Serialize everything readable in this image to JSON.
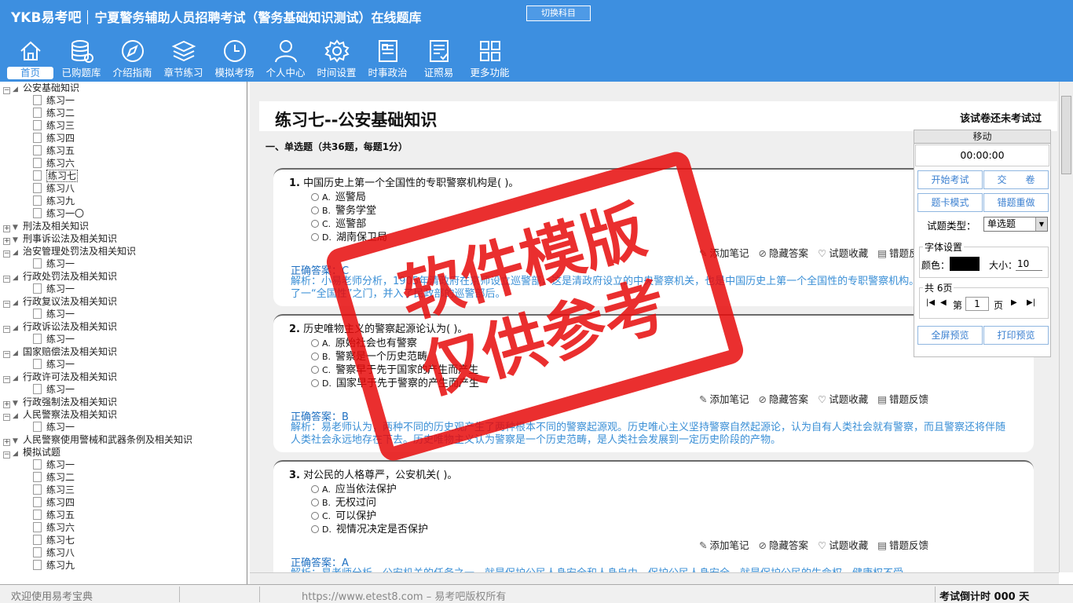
{
  "header": {
    "logo": "YKB易考吧",
    "title": "宁夏警务辅助人员招聘考试（警务基础知识测试）在线题库",
    "switch_label": "切换科目"
  },
  "nav": [
    {
      "label": "首页",
      "icon": "home-icon"
    },
    {
      "label": "已购题库",
      "icon": "database-icon"
    },
    {
      "label": "介绍指南",
      "icon": "compass-icon"
    },
    {
      "label": "章节练习",
      "icon": "layers-icon"
    },
    {
      "label": "模拟考场",
      "icon": "clock-icon"
    },
    {
      "label": "个人中心",
      "icon": "user-icon"
    },
    {
      "label": "时间设置",
      "icon": "gear-icon"
    },
    {
      "label": "时事政治",
      "icon": "news-icon"
    },
    {
      "label": "证照易",
      "icon": "certificate-icon"
    },
    {
      "label": "更多功能",
      "icon": "grid-icon"
    }
  ],
  "tree": [
    {
      "label": "公安基础知识",
      "expanded": true,
      "children": [
        "练习一",
        "练习二",
        "练习三",
        "练习四",
        "练习五",
        "练习六",
        "练习七",
        "练习八",
        "练习九",
        "练习一〇"
      ],
      "selected": "练习七"
    },
    {
      "label": "刑法及相关知识",
      "expanded": false,
      "children": []
    },
    {
      "label": "刑事诉讼法及相关知识",
      "expanded": false,
      "children": []
    },
    {
      "label": "治安管理处罚法及相关知识",
      "expanded": true,
      "children": [
        "练习一"
      ]
    },
    {
      "label": "行政处罚法及相关知识",
      "expanded": true,
      "children": [
        "练习一"
      ]
    },
    {
      "label": "行政复议法及相关知识",
      "expanded": true,
      "children": [
        "练习一"
      ]
    },
    {
      "label": "行政诉讼法及相关知识",
      "expanded": true,
      "children": [
        "练习一"
      ]
    },
    {
      "label": "国家赔偿法及相关知识",
      "expanded": true,
      "children": [
        "练习一"
      ]
    },
    {
      "label": "行政许可法及相关知识",
      "expanded": true,
      "children": [
        "练习一"
      ]
    },
    {
      "label": "行政强制法及相关知识",
      "expanded": false,
      "children": []
    },
    {
      "label": "人民警察法及相关知识",
      "expanded": true,
      "children": [
        "练习一"
      ]
    },
    {
      "label": "人民警察使用警械和武器条例及相关知识",
      "expanded": false,
      "children": []
    },
    {
      "label": "模拟试题",
      "expanded": true,
      "children": [
        "练习一",
        "练习二",
        "练习三",
        "练习四",
        "练习五",
        "练习六",
        "练习七",
        "练习八",
        "练习九"
      ]
    }
  ],
  "paper": {
    "title": "练习七--公安基础知识",
    "status": "该试卷还未考试过",
    "section": "一、单选题（共36题，每题1分）"
  },
  "questions": [
    {
      "number": "1.",
      "text": "中国历史上第一个全国性的专职警察机构是(    )。",
      "options": [
        [
          "A.",
          "巡警局"
        ],
        [
          "B.",
          "警务学堂"
        ],
        [
          "C.",
          "巡警部"
        ],
        [
          "D.",
          "湖南保卫局"
        ]
      ],
      "answer": "正确答案：C",
      "analysis": "解析：小易老师分析，1905年清政府在京师设立巡警部，这是清政府设立的中央警察机关，也是中国历史上第一个全国性的专职警察机构。巡警部同时要抓住了一“全国性”之门，并入了民政部的巡警部后。"
    },
    {
      "number": "2.",
      "text": "历史唯物主义的警察起源论认为(    )。",
      "options": [
        [
          "A.",
          "原始社会也有警察"
        ],
        [
          "B.",
          "警察是一个历史范畴"
        ],
        [
          "C.",
          "警察早于先于国家的产生而产生"
        ],
        [
          "D.",
          "国家早于先于警察的产生而产生"
        ]
      ],
      "answer": "正确答案：B",
      "analysis": "解析：易老师认为，两种不同的历史观产生了两种根本不同的警察起源观。历史唯心主义坚持警察自然起源论，认为自有人类社会就有警察，而且警察还将伴随人类社会永远地存在下去。历史唯物主义认为警察是一个历史范畴，是人类社会发展到一定历史阶段的产物。"
    },
    {
      "number": "3.",
      "text": "对公民的人格尊严，公安机关(    )。",
      "options": [
        [
          "A.",
          "应当依法保护"
        ],
        [
          "B.",
          "无权过问"
        ],
        [
          "C.",
          "可以保护"
        ],
        [
          "D.",
          "视情况决定是否保护"
        ]
      ],
      "answer": "正确答案：A",
      "analysis": "解析：易老师分析，公安机关的任务之一，就是保护公民人身安全和人身自由，保护公民人身安全，就是保护公民的生命权、健康权不受..."
    }
  ],
  "tools": {
    "note": "添加笔记",
    "hide": "隐藏答案",
    "fav": "试题收藏",
    "feedback": "错题反馈"
  },
  "panel": {
    "move": "移动",
    "timer": "00:00:00",
    "start": "开始考试",
    "submit": "交　　卷",
    "card_mode": "题卡模式",
    "redo_wrong": "错题重做",
    "qtype_label": "试题类型：",
    "qtype_value": "单选题",
    "font_legend": "字体设置",
    "color_label": "颜色：",
    "size_label": "大小：",
    "size_value": "10",
    "pages_legend": "共 6页",
    "page_prefix": "第",
    "page_value": "1",
    "page_suffix": "页",
    "fullscreen": "全屏预览",
    "print": "打印预览"
  },
  "statusbar": {
    "welcome": "欢迎使用易考宝典",
    "copyright": "https://www.etest8.com – 易考吧版权所有",
    "countdown": "考试倒计时  000 天"
  },
  "watermark": {
    "line1": "软件模版",
    "line2": "仅供参考"
  },
  "colors": {
    "header_bg": "#3d8fe0",
    "answer": "#1e6fc1",
    "analysis": "#3a8fd6",
    "watermark": "#e60a0a"
  }
}
